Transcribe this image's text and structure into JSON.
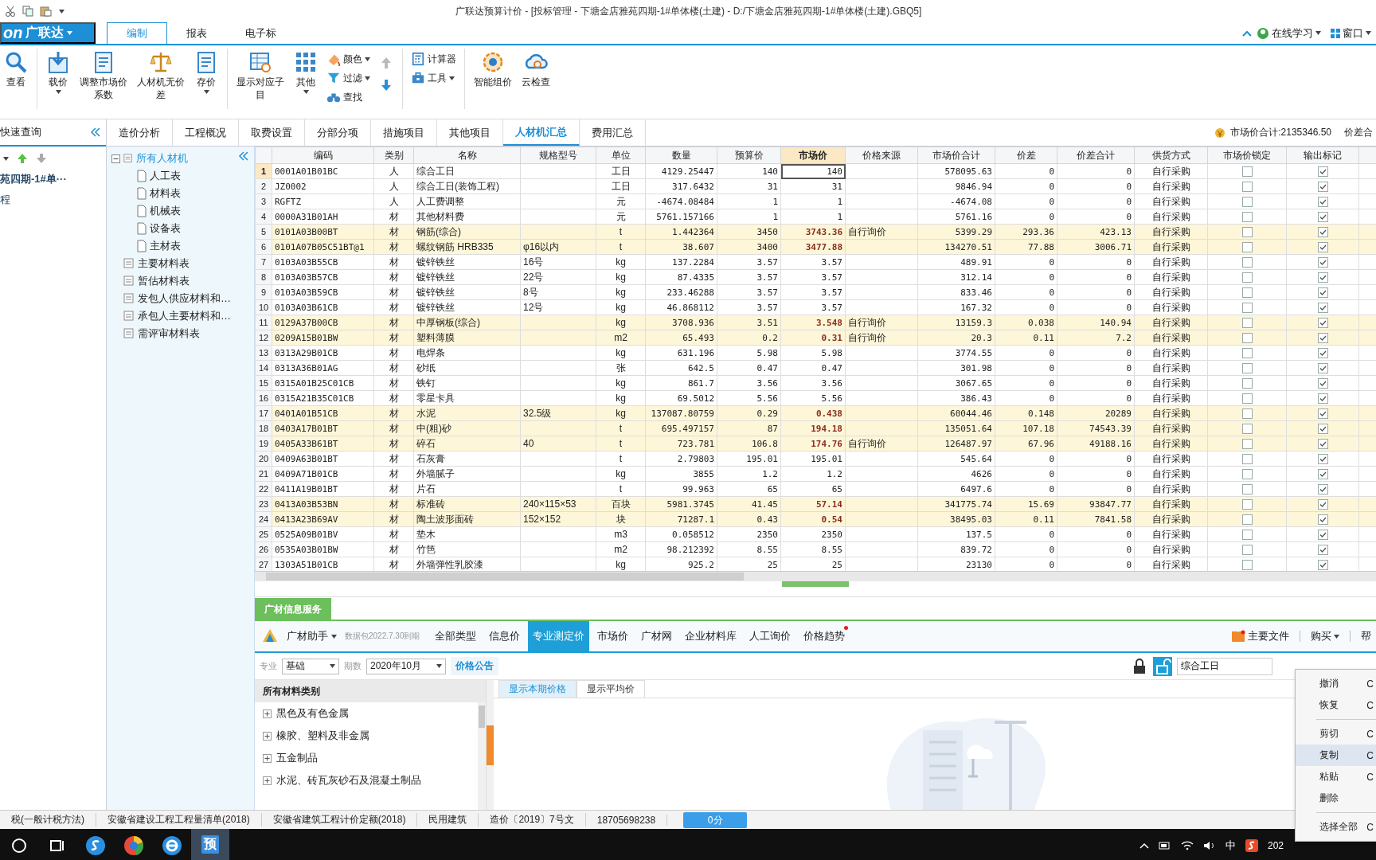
{
  "title_bar": {
    "title": "广联达预算计价 - [投标管理 - 下塘金店雅苑四期-1#单体楼(土建) - D:/下塘金店雅苑四期-1#单体楼(土建).GBQ5]"
  },
  "app_menu": {
    "logo": "on",
    "label": "广联达"
  },
  "ribbon_tabs": [
    {
      "label": "编制",
      "selected": true
    },
    {
      "label": "报表",
      "selected": false
    },
    {
      "label": "电子标",
      "selected": false
    }
  ],
  "top_right": {
    "online_learning": "在线学习",
    "window": "窗口"
  },
  "ribbon": [
    {
      "kind": "large",
      "label": "查看",
      "dropdown": false
    },
    {
      "kind": "separator"
    },
    {
      "kind": "large",
      "label": "载价",
      "dropdown": true
    },
    {
      "kind": "large",
      "label": "调整市场价系数",
      "dropdown": false
    },
    {
      "kind": "large",
      "label": "人材机无价差",
      "dropdown": false
    },
    {
      "kind": "large",
      "label": "存价",
      "dropdown": true
    },
    {
      "kind": "separator"
    },
    {
      "kind": "large",
      "label": "显示对应子目",
      "dropdown": false
    },
    {
      "kind": "large",
      "label": "其他",
      "dropdown": true
    },
    {
      "kind": "small_stack",
      "items": [
        {
          "label": "颜色",
          "dropdown": true
        },
        {
          "label": "过滤",
          "dropdown": true
        },
        {
          "label": "查找",
          "dropdown": false
        }
      ]
    },
    {
      "kind": "arrows"
    },
    {
      "kind": "separator"
    },
    {
      "kind": "small_stack",
      "items": [
        {
          "label": "计算器",
          "dropdown": false
        },
        {
          "label": "工具",
          "dropdown": true
        }
      ]
    },
    {
      "kind": "separator"
    },
    {
      "kind": "large",
      "label": "智能组价",
      "dropdown": false
    },
    {
      "kind": "large",
      "label": "云检查",
      "dropdown": false
    }
  ],
  "sidebar": {
    "title": "快速查询",
    "project": "苑四期-1#单···",
    "item": "程"
  },
  "view_tabs": [
    {
      "label": "造价分析",
      "selected": false
    },
    {
      "label": "工程概况",
      "selected": false
    },
    {
      "label": "取费设置",
      "selected": false
    },
    {
      "label": "分部分项",
      "selected": false
    },
    {
      "label": "措施项目",
      "selected": false
    },
    {
      "label": "其他项目",
      "selected": false
    },
    {
      "label": "人材机汇总",
      "selected": true
    },
    {
      "label": "费用汇总",
      "selected": false
    }
  ],
  "summary": {
    "market_total": "市场价合计:2135346.50",
    "diff_total": "价差合"
  },
  "tree": [
    {
      "label": "所有人材机",
      "selected": true,
      "expanded": true,
      "children": [
        {
          "label": "人工表",
          "selected": false
        },
        {
          "label": "材料表",
          "selected": false
        },
        {
          "label": "机械表",
          "selected": false
        },
        {
          "label": "设备表",
          "selected": false
        },
        {
          "label": "主材表",
          "selected": false
        }
      ]
    },
    {
      "label": "主要材料表",
      "selected": false
    },
    {
      "label": "暂估材料表",
      "selected": false
    },
    {
      "label": "发包人供应材料和…",
      "selected": false
    },
    {
      "label": "承包人主要材料和…",
      "selected": false
    },
    {
      "label": "需评审材料表",
      "selected": false
    }
  ],
  "table": {
    "columns": [
      {
        "label": "编码",
        "selected": false
      },
      {
        "label": "类别",
        "selected": false
      },
      {
        "label": "名称",
        "selected": false
      },
      {
        "label": "规格型号",
        "selected": false
      },
      {
        "label": "单位",
        "selected": false
      },
      {
        "label": "数量",
        "selected": false
      },
      {
        "label": "预算价",
        "selected": false
      },
      {
        "label": "市场价",
        "selected": true
      },
      {
        "label": "价格来源",
        "selected": false
      },
      {
        "label": "市场价合计",
        "selected": false
      },
      {
        "label": "价差",
        "selected": false
      },
      {
        "label": "价差合计",
        "selected": false
      },
      {
        "label": "供货方式",
        "selected": false
      },
      {
        "label": "市场价锁定",
        "selected": false
      },
      {
        "label": "输出标记",
        "selected": false
      }
    ],
    "rows": [
      {
        "num": "1",
        "cells": [
          "0001A01B01BC",
          "人",
          "综合工日",
          "",
          "工日",
          "4129.25447",
          "140",
          "140",
          "",
          "578095.63",
          "0",
          "0",
          "自行采购"
        ],
        "highlighted": false,
        "selected": true,
        "locked": false,
        "output": true
      },
      {
        "num": "2",
        "cells": [
          "JZ0002",
          "人",
          "综合工日(装饰工程)",
          "",
          "工日",
          "317.6432",
          "31",
          "31",
          "",
          "9846.94",
          "0",
          "0",
          "自行采购"
        ],
        "highlighted": false,
        "selected": false,
        "locked": false,
        "output": true
      },
      {
        "num": "3",
        "cells": [
          "RGFTZ",
          "人",
          "人工费调整",
          "",
          "元",
          "-4674.08484",
          "1",
          "1",
          "",
          "-4674.08",
          "0",
          "0",
          "自行采购"
        ],
        "highlighted": false,
        "selected": false,
        "locked": false,
        "output": true
      },
      {
        "num": "4",
        "cells": [
          "0000A31B01AH",
          "材",
          "其他材料费",
          "",
          "元",
          "5761.157166",
          "1",
          "1",
          "",
          "5761.16",
          "0",
          "0",
          "自行采购"
        ],
        "highlighted": false,
        "selected": false,
        "locked": false,
        "output": true
      },
      {
        "num": "5",
        "cells": [
          "0101A03B00BT",
          "材",
          "钢筋(综合)",
          "",
          "t",
          "1.442364",
          "3450",
          "3743.36",
          "自行询价",
          "5399.29",
          "293.36",
          "423.13",
          "自行采购"
        ],
        "highlighted": true,
        "selected": false,
        "locked": false,
        "output": true
      },
      {
        "num": "6",
        "cells": [
          "0101A07B05C51BT@1",
          "材",
          "螺纹钢筋 HRB335",
          "φ16以内",
          "t",
          "38.607",
          "3400",
          "3477.88",
          "",
          "134270.51",
          "77.88",
          "3006.71",
          "自行采购"
        ],
        "highlighted": true,
        "selected": false,
        "locked": false,
        "output": true
      },
      {
        "num": "7",
        "cells": [
          "0103A03B55CB",
          "材",
          "镀锌铁丝",
          "16号",
          "kg",
          "137.2284",
          "3.57",
          "3.57",
          "",
          "489.91",
          "0",
          "0",
          "自行采购"
        ],
        "highlighted": false,
        "selected": false,
        "locked": false,
        "output": true
      },
      {
        "num": "8",
        "cells": [
          "0103A03B57CB",
          "材",
          "镀锌铁丝",
          "22号",
          "kg",
          "87.4335",
          "3.57",
          "3.57",
          "",
          "312.14",
          "0",
          "0",
          "自行采购"
        ],
        "highlighted": false,
        "selected": false,
        "locked": false,
        "output": true
      },
      {
        "num": "9",
        "cells": [
          "0103A03B59CB",
          "材",
          "镀锌铁丝",
          "8号",
          "kg",
          "233.46288",
          "3.57",
          "3.57",
          "",
          "833.46",
          "0",
          "0",
          "自行采购"
        ],
        "highlighted": false,
        "selected": false,
        "locked": false,
        "output": true
      },
      {
        "num": "10",
        "cells": [
          "0103A03B61CB",
          "材",
          "镀锌铁丝",
          "12号",
          "kg",
          "46.868112",
          "3.57",
          "3.57",
          "",
          "167.32",
          "0",
          "0",
          "自行采购"
        ],
        "highlighted": false,
        "selected": false,
        "locked": false,
        "output": true
      },
      {
        "num": "11",
        "cells": [
          "0129A37B00CB",
          "材",
          "中厚钢板(综合)",
          "",
          "kg",
          "3708.936",
          "3.51",
          "3.548",
          "自行询价",
          "13159.3",
          "0.038",
          "140.94",
          "自行采购"
        ],
        "highlighted": true,
        "selected": false,
        "locked": false,
        "output": true
      },
      {
        "num": "12",
        "cells": [
          "0209A15B01BW",
          "材",
          "塑料薄膜",
          "",
          "m2",
          "65.493",
          "0.2",
          "0.31",
          "自行询价",
          "20.3",
          "0.11",
          "7.2",
          "自行采购"
        ],
        "highlighted": true,
        "selected": false,
        "locked": false,
        "output": true
      },
      {
        "num": "13",
        "cells": [
          "0313A29B01CB",
          "材",
          "电焊条",
          "",
          "kg",
          "631.196",
          "5.98",
          "5.98",
          "",
          "3774.55",
          "0",
          "0",
          "自行采购"
        ],
        "highlighted": false,
        "selected": false,
        "locked": false,
        "output": true
      },
      {
        "num": "14",
        "cells": [
          "0313A36B01AG",
          "材",
          "砂纸",
          "",
          "张",
          "642.5",
          "0.47",
          "0.47",
          "",
          "301.98",
          "0",
          "0",
          "自行采购"
        ],
        "highlighted": false,
        "selected": false,
        "locked": false,
        "output": true
      },
      {
        "num": "15",
        "cells": [
          "0315A01B25C01CB",
          "材",
          "铁钉",
          "",
          "kg",
          "861.7",
          "3.56",
          "3.56",
          "",
          "3067.65",
          "0",
          "0",
          "自行采购"
        ],
        "highlighted": false,
        "selected": false,
        "locked": false,
        "output": true
      },
      {
        "num": "16",
        "cells": [
          "0315A21B35C01CB",
          "材",
          "零星卡具",
          "",
          "kg",
          "69.5012",
          "5.56",
          "5.56",
          "",
          "386.43",
          "0",
          "0",
          "自行采购"
        ],
        "highlighted": false,
        "selected": false,
        "locked": false,
        "output": true
      },
      {
        "num": "17",
        "cells": [
          "0401A01B51CB",
          "材",
          "水泥",
          "32.5级",
          "kg",
          "137087.80759",
          "0.29",
          "0.438",
          "",
          "60044.46",
          "0.148",
          "20289",
          "自行采购"
        ],
        "highlighted": true,
        "selected": false,
        "locked": false,
        "output": true
      },
      {
        "num": "18",
        "cells": [
          "0403A17B01BT",
          "材",
          "中(粗)砂",
          "",
          "t",
          "695.497157",
          "87",
          "194.18",
          "",
          "135051.64",
          "107.18",
          "74543.39",
          "自行采购"
        ],
        "highlighted": true,
        "selected": false,
        "locked": false,
        "output": true
      },
      {
        "num": "19",
        "cells": [
          "0405A33B61BT",
          "材",
          "碎石",
          "40",
          "t",
          "723.781",
          "106.8",
          "174.76",
          "自行询价",
          "126487.97",
          "67.96",
          "49188.16",
          "自行采购"
        ],
        "highlighted": true,
        "selected": false,
        "locked": false,
        "output": true
      },
      {
        "num": "20",
        "cells": [
          "0409A63B01BT",
          "材",
          "石灰膏",
          "",
          "t",
          "2.79803",
          "195.01",
          "195.01",
          "",
          "545.64",
          "0",
          "0",
          "自行采购"
        ],
        "highlighted": false,
        "selected": false,
        "locked": false,
        "output": true
      },
      {
        "num": "21",
        "cells": [
          "0409A71B01CB",
          "材",
          "外墙腻子",
          "",
          "kg",
          "3855",
          "1.2",
          "1.2",
          "",
          "4626",
          "0",
          "0",
          "自行采购"
        ],
        "highlighted": false,
        "selected": false,
        "locked": false,
        "output": true
      },
      {
        "num": "22",
        "cells": [
          "0411A19B01BT",
          "材",
          "片石",
          "",
          "t",
          "99.963",
          "65",
          "65",
          "",
          "6497.6",
          "0",
          "0",
          "自行采购"
        ],
        "highlighted": false,
        "selected": false,
        "locked": false,
        "output": true
      },
      {
        "num": "23",
        "cells": [
          "0413A03B53BN",
          "材",
          "标准砖",
          "240×115×53",
          "百块",
          "5981.3745",
          "41.45",
          "57.14",
          "",
          "341775.74",
          "15.69",
          "93847.77",
          "自行采购"
        ],
        "highlighted": true,
        "selected": false,
        "locked": false,
        "output": true
      },
      {
        "num": "24",
        "cells": [
          "0413A23B69AV",
          "材",
          "陶土波形面砖",
          "152×152",
          "块",
          "71287.1",
          "0.43",
          "0.54",
          "",
          "38495.03",
          "0.11",
          "7841.58",
          "自行采购"
        ],
        "highlighted": true,
        "selected": false,
        "locked": false,
        "output": true
      },
      {
        "num": "25",
        "cells": [
          "0525A09B01BV",
          "材",
          "垫木",
          "",
          "m3",
          "0.058512",
          "2350",
          "2350",
          "",
          "137.5",
          "0",
          "0",
          "自行采购"
        ],
        "highlighted": false,
        "selected": false,
        "locked": false,
        "output": true
      },
      {
        "num": "26",
        "cells": [
          "0535A03B01BW",
          "材",
          "竹笆",
          "",
          "m2",
          "98.212392",
          "8.55",
          "8.55",
          "",
          "839.72",
          "0",
          "0",
          "自行采购"
        ],
        "highlighted": false,
        "selected": false,
        "locked": false,
        "output": true
      },
      {
        "num": "27",
        "cells": [
          "1303A51B01CB",
          "材",
          "外墙弹性乳胶漆",
          "",
          "kg",
          "925.2",
          "25",
          "25",
          "",
          "23130",
          "0",
          "0",
          "自行采购"
        ],
        "highlighted": false,
        "selected": false,
        "locked": false,
        "output": true
      }
    ]
  },
  "info_service": {
    "tab": "广材信息服务",
    "assistant": "广材助手",
    "package": "数据包2022.7.30到期",
    "tabs": [
      {
        "label": "全部类型",
        "selected": false,
        "badge": false
      },
      {
        "label": "信息价",
        "selected": false,
        "badge": false
      },
      {
        "label": "专业测定价",
        "selected": true,
        "badge": false
      },
      {
        "label": "市场价",
        "selected": false,
        "badge": false
      },
      {
        "label": "广材网",
        "selected": false,
        "badge": false
      },
      {
        "label": "企业材料库",
        "selected": false,
        "badge": false
      },
      {
        "label": "人工询价",
        "selected": false,
        "badge": false
      },
      {
        "label": "价格趋势",
        "selected": false,
        "badge": true
      }
    ],
    "docs": "主要文件",
    "buy": "购买",
    "help": "帮"
  },
  "filter": {
    "specialty_label": "专业",
    "specialty": "基础",
    "period_label": "期数",
    "period": "2020年10月",
    "notice": "价格公告",
    "search": "综合工日"
  },
  "categories": {
    "title": "所有材料类别",
    "items": [
      "黑色及有色金属",
      "橡胶、塑料及非金属",
      "五金制品",
      "水泥、砖瓦灰砂石及混凝土制品"
    ]
  },
  "price_tabs": [
    {
      "label": "显示本期价格",
      "selected": true
    },
    {
      "label": "显示平均价",
      "selected": false
    }
  ],
  "status_bar": {
    "items": [
      "税(一般计税方法)",
      "安徽省建设工程工程量清单(2018)",
      "安徽省建筑工程计价定额(2018)",
      "民用建筑",
      "造价〔2019〕7号文",
      "18705698238"
    ],
    "score": "0分"
  },
  "context_menu": [
    {
      "kind": "item",
      "label": "撤消",
      "shortcut": "C",
      "selected": false
    },
    {
      "kind": "item",
      "label": "恢复",
      "shortcut": "C",
      "selected": false
    },
    {
      "kind": "separator"
    },
    {
      "kind": "item",
      "label": "剪切",
      "shortcut": "C",
      "selected": false
    },
    {
      "kind": "item",
      "label": "复制",
      "shortcut": "C",
      "selected": true
    },
    {
      "kind": "item",
      "label": "粘贴",
      "shortcut": "C",
      "selected": false
    },
    {
      "kind": "item",
      "label": "删除",
      "selected": false
    },
    {
      "kind": "separator"
    },
    {
      "kind": "item",
      "label": "选择全部",
      "shortcut": "C",
      "selected": false
    }
  ],
  "taskbar": {
    "active_app": "预",
    "ime": "中",
    "clock": "202"
  }
}
